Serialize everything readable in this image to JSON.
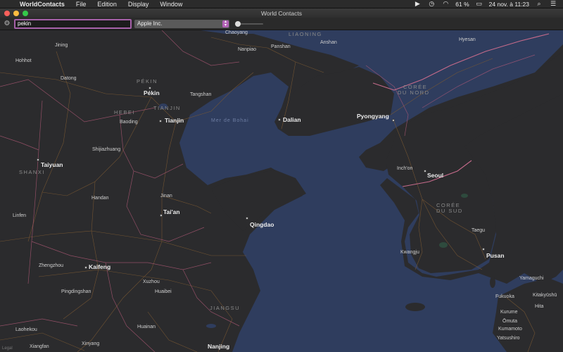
{
  "menubar": {
    "app_name": "WorldContacts",
    "items": [
      "File",
      "Edition",
      "Display",
      "Window"
    ],
    "battery": "61 %",
    "datetime": "24 nov. à 11:23"
  },
  "window": {
    "title": "World Contacts"
  },
  "toolbar": {
    "search_value": "pekin",
    "company_selected": "Apple Inc."
  },
  "map": {
    "sea_labels": {
      "bohai": "Mer de Bohai"
    },
    "regions": {
      "liaoning": "LIAONING",
      "pekin": "PÉKIN",
      "hebei": "HEBEI",
      "tianjin": "TIANJIN",
      "shanxi": "SHANXI",
      "coree_nord_1": "CORÉE",
      "coree_nord_2": "DU NORD",
      "coree_sud_1": "CORÉE",
      "coree_sud_2": "DU SUD",
      "jiangsu": "JIANGSU"
    },
    "cities": {
      "pekin": "Pékin",
      "tianjin": "Tianjin",
      "dalian": "Dalian",
      "pyongyang": "Pyongyang",
      "seoul": "Seoul",
      "taiyuan": "Taiyuan",
      "taian": "Tai'an",
      "qingdao": "Qingdao",
      "kaifeng": "Kaifeng",
      "pusan": "Pusan",
      "nanjing": "Nanjing"
    },
    "towns": {
      "chaoyang": "Chaoyang",
      "anshan": "Anshan",
      "panshan": "Panshan",
      "hyesan": "Hyesan",
      "jining": "Jining",
      "hohhot": "Hohhot",
      "datong": "Datong",
      "tangshan": "Tangshan",
      "baoding": "Baoding",
      "shijiazhuang": "Shijiazhuang",
      "nanpiao": "Nanpiao",
      "incheon": "Inch'on",
      "handan": "Handan",
      "jinan": "Jinan",
      "linfen": "Linfen",
      "taegu": "Taegu",
      "kwangju": "Kwangju",
      "zhengzhou": "Zhengzhou",
      "xuzhou": "Xuzhou",
      "huaibei": "Huaibei",
      "pingdingshan": "Pingdingshan",
      "yamaguchi": "Yamaguchi",
      "kitakyushu": "Kitakyūshū",
      "fukuoka": "Fukuoka",
      "hita": "Hita",
      "kurume": "Kurume",
      "omuta": "Ōmuta",
      "kumamoto": "Kumamoto",
      "yatsushiro": "Yatsushiro",
      "huainan": "Huainan",
      "laohekou": "Laohekou",
      "xinyang": "Xinyang",
      "xiangfan": "Xiangfan"
    },
    "legal": "Legal"
  }
}
